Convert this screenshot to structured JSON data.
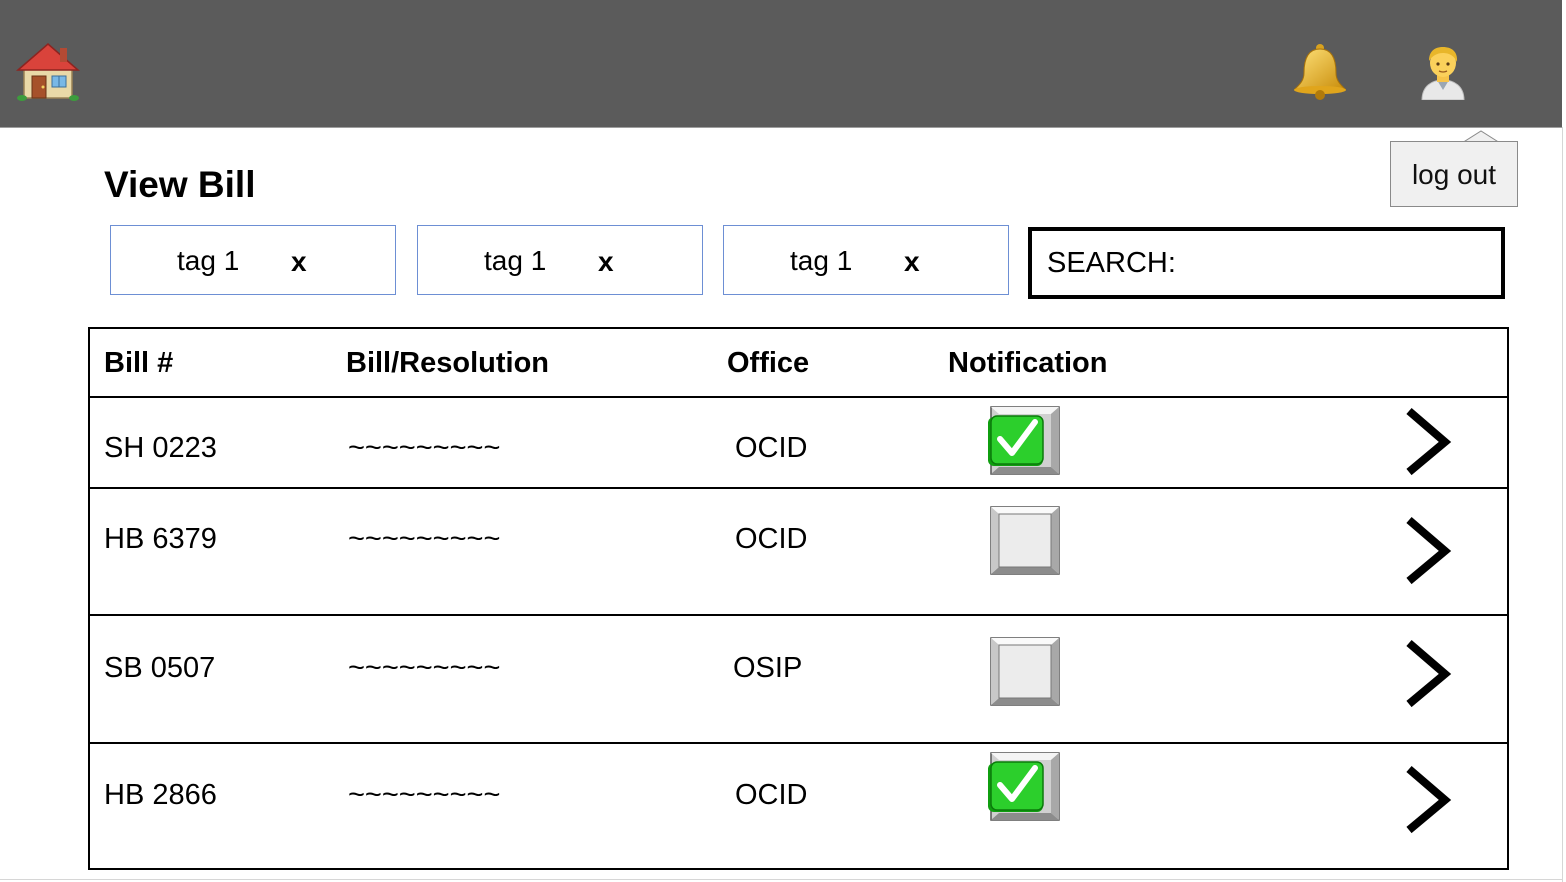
{
  "header": {
    "home_icon": "house-icon",
    "bell_icon": "bell-icon",
    "user_icon": "person-icon",
    "background_color": "#5b5b5b"
  },
  "logout_label": "log out",
  "page_title": "View Bill",
  "tags": [
    {
      "label": "tag 1",
      "remove_label": "x"
    },
    {
      "label": "tag 1",
      "remove_label": "x"
    },
    {
      "label": "tag 1",
      "remove_label": "x"
    }
  ],
  "search": {
    "label": "SEARCH:",
    "value": ""
  },
  "table": {
    "headers": {
      "bill_no": "Bill #",
      "description": "Bill/Resolution",
      "office": "Office",
      "notification": "Notification"
    },
    "rows": [
      {
        "bill_no": "SH 0223",
        "description": "~~~~~~~~~",
        "office": "OCID",
        "notification": true
      },
      {
        "bill_no": "HB 6379",
        "description": "~~~~~~~~~",
        "office": "OCID",
        "notification": false
      },
      {
        "bill_no": "SB 0507",
        "description": "~~~~~~~~~",
        "office": "OSIP",
        "notification": false
      },
      {
        "bill_no": "HB 2866",
        "description": "~~~~~~~~~",
        "office": "OCID",
        "notification": true
      }
    ]
  },
  "colors": {
    "check_green": "#16b816",
    "tag_border": "#6d8fd4"
  }
}
